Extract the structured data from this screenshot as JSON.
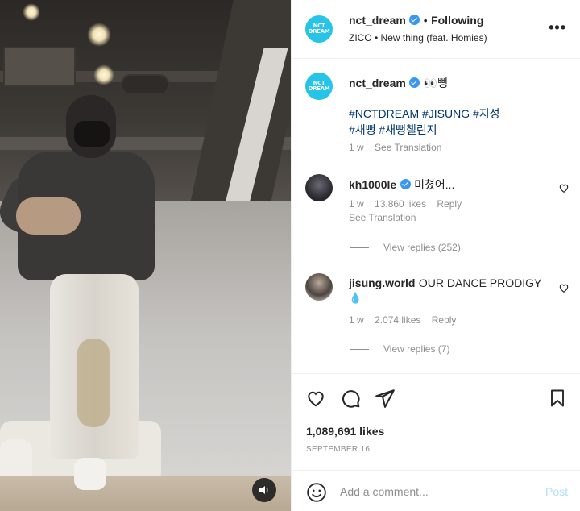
{
  "post": {
    "account": "nct_dream",
    "separator": "•",
    "follow_state": "Following",
    "audio": "ZICO • New thing (feat. Homies)",
    "avatar_text": "NCT DREAM",
    "more_label": "•••"
  },
  "caption": {
    "username": "nct_dream",
    "text": "👀뻥",
    "hashtags_line1": "#NCTDREAM #JISUNG #지성",
    "hashtags_line2": "#새뻥 #새뻥챌린지",
    "time": "1 w",
    "see_translation": "See Translation"
  },
  "comments": [
    {
      "username": "kh1000le",
      "text": "미쳤어...",
      "time": "1 w",
      "likes": "13.860 likes",
      "reply": "Reply",
      "see_translation": "See Translation",
      "view_replies": "View replies (252)"
    },
    {
      "username": "jisung.world",
      "text": "OUR DANCE PRODIGY",
      "emoji": "💧",
      "time": "1 w",
      "likes": "2.074 likes",
      "reply": "Reply",
      "view_replies": "View replies (7)"
    }
  ],
  "engagement": {
    "likes": "1,089,691 likes",
    "date": "SEPTEMBER 16"
  },
  "composer": {
    "placeholder": "Add a comment...",
    "post_label": "Post"
  },
  "colors": {
    "brand_avatar": "#26c4e8",
    "verified": "#3897f0",
    "hashtag": "#00376b",
    "post_disabled": "#b2dffc"
  },
  "icons": [
    "sound-icon",
    "verified-icon",
    "more-icon",
    "heart-icon",
    "comment-icon",
    "share-icon",
    "bookmark-icon",
    "emoji-icon"
  ]
}
